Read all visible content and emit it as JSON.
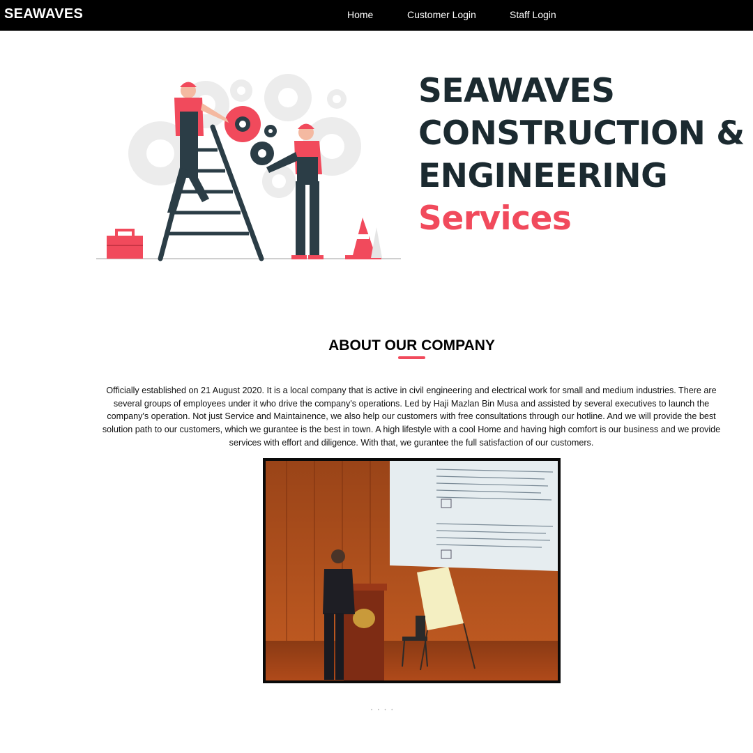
{
  "header": {
    "brand": "SEAWAVES",
    "nav": [
      {
        "label": "Home"
      },
      {
        "label": "Customer Login"
      },
      {
        "label": "Staff Login"
      }
    ]
  },
  "hero": {
    "title_lines": [
      "SEAWAVES",
      "CONSTRUCTION &",
      "ENGINEERING"
    ],
    "accent": "Services",
    "accent_color": "#f14a5c",
    "text_color": "#1b2a30"
  },
  "about": {
    "heading": "ABOUT OUR COMPANY",
    "body": "Officially established on 21 August 2020. It is a local company that is active in civil engineering and electrical work for small and medium industries. There are several groups of employees under it who drive the company's operations. Led by Haji Mazlan Bin Musa and assisted by several executives to launch the company's operation. Not just Service and Maintainence, we also help our customers with free consultations through our hotline. And we will provide the best solution path to our customers, which we gurantee is the best in town. A high lifestyle with a cool Home and having high comfort is our business and we provide services with effort and diligence. With that, we gurantee the full satisfaction of our customers."
  },
  "icons": {
    "illustration": "construction-workers-gears-illustration",
    "photo": "speaker-at-podium-photo"
  }
}
